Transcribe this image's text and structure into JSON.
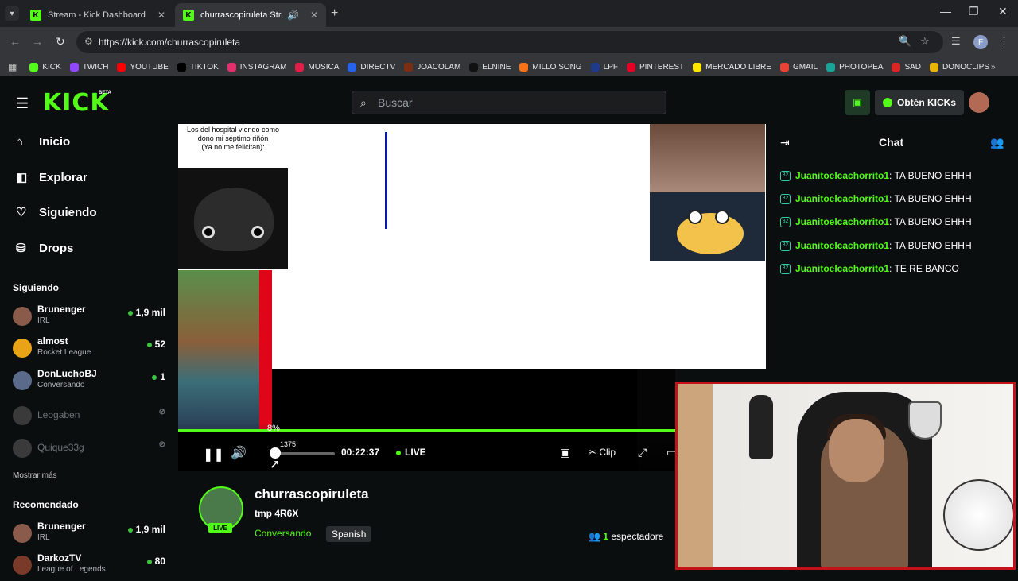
{
  "browser": {
    "tabs": [
      {
        "title": "Stream - Kick Dashboard",
        "active": false
      },
      {
        "title": "churrascopiruleta Stream -",
        "active": true
      }
    ],
    "url": "https://kick.com/churrascopiruleta",
    "profile_initial": "F",
    "bookmarks": [
      {
        "label": "KICK",
        "color": "#53fc18"
      },
      {
        "label": "TWICH",
        "color": "#9146ff"
      },
      {
        "label": "YOUTUBE",
        "color": "#ff0000"
      },
      {
        "label": "TIKTOK",
        "color": "#000000"
      },
      {
        "label": "INSTAGRAM",
        "color": "#e1306c"
      },
      {
        "label": "MUSICA",
        "color": "#e11d48"
      },
      {
        "label": "DIRECTV",
        "color": "#2563eb"
      },
      {
        "label": "JOACOLAM",
        "color": "#7c2d12"
      },
      {
        "label": "ELNINE",
        "color": "#111111"
      },
      {
        "label": "MILLO SONG",
        "color": "#f97316"
      },
      {
        "label": "LPF",
        "color": "#1e3a8a"
      },
      {
        "label": "PINTEREST",
        "color": "#e60023"
      },
      {
        "label": "MERCADO LIBRE",
        "color": "#ffe600"
      },
      {
        "label": "GMAIL",
        "color": "#ea4335"
      },
      {
        "label": "PHOTOPEA",
        "color": "#18a497"
      },
      {
        "label": "SAD",
        "color": "#dc2626"
      },
      {
        "label": "DONOCLIPS",
        "color": "#eab308"
      }
    ]
  },
  "header": {
    "logo": "KICK",
    "beta": "BETA",
    "search_placeholder": "Buscar",
    "kicks_button": "Obtén KICKs"
  },
  "sidebar": {
    "nav": [
      {
        "label": "Inicio",
        "icon": "home-icon"
      },
      {
        "label": "Explorar",
        "icon": "compass-icon"
      },
      {
        "label": "Siguiendo",
        "icon": "heart-icon"
      },
      {
        "label": "Drops",
        "icon": "gift-icon"
      }
    ],
    "following_title": "Siguiendo",
    "following": [
      {
        "name": "Brunenger",
        "category": "IRL",
        "viewers": "1,9 mil",
        "online": true,
        "color": "#8a5a4a"
      },
      {
        "name": "almost",
        "category": "Rocket League",
        "viewers": "52",
        "online": true,
        "color": "#e8a317"
      },
      {
        "name": "DonLuchoBJ",
        "category": "Conversando",
        "viewers": "1",
        "online": true,
        "color": "#5a6a8a"
      },
      {
        "name": "Leogaben",
        "category": "",
        "viewers": "",
        "online": false,
        "color": "#3a3a3a"
      },
      {
        "name": "Quique33g",
        "category": "",
        "viewers": "",
        "online": false,
        "color": "#3a3a3a"
      }
    ],
    "show_more": "Mostrar más",
    "recommended_title": "Recomendado",
    "recommended": [
      {
        "name": "Brunenger",
        "category": "IRL",
        "viewers": "1,9 mil",
        "color": "#8a5a4a"
      },
      {
        "name": "DarkozTV",
        "category": "League of Legends",
        "viewers": "80",
        "color": "#7a3a2a"
      }
    ]
  },
  "stream_overlay": {
    "meme_text": "Los del hospital viendo como dono mi séptimo riñón\n(Ya no me felicitan):"
  },
  "player": {
    "volume_percent": "8%",
    "volume_fraction": 0.08,
    "volume_tooltip": "1375",
    "elapsed": "00:22:37",
    "live_label": "LIVE",
    "clip_label": "Clip"
  },
  "channel": {
    "name": "churrascopiruleta",
    "title": "tmp 4R6X",
    "category": "Conversando",
    "language": "Spanish",
    "live_badge": "LIVE",
    "viewers_count": "1",
    "viewers_label": "espectadore"
  },
  "chat": {
    "title": "Chat",
    "messages": [
      {
        "badge": "32",
        "user": "Juanitoelcachorrito1",
        "text": "TA BUENO EHHH"
      },
      {
        "badge": "32",
        "user": "Juanitoelcachorrito1",
        "text": "TA BUENO EHHH"
      },
      {
        "badge": "32",
        "user": "Juanitoelcachorrito1",
        "text": "TA BUENO EHHH"
      },
      {
        "badge": "32",
        "user": "Juanitoelcachorrito1",
        "text": "TA BUENO EHHH"
      },
      {
        "badge": "32",
        "user": "Juanitoelcachorrito1",
        "text": "TE RE BANCO"
      }
    ]
  }
}
